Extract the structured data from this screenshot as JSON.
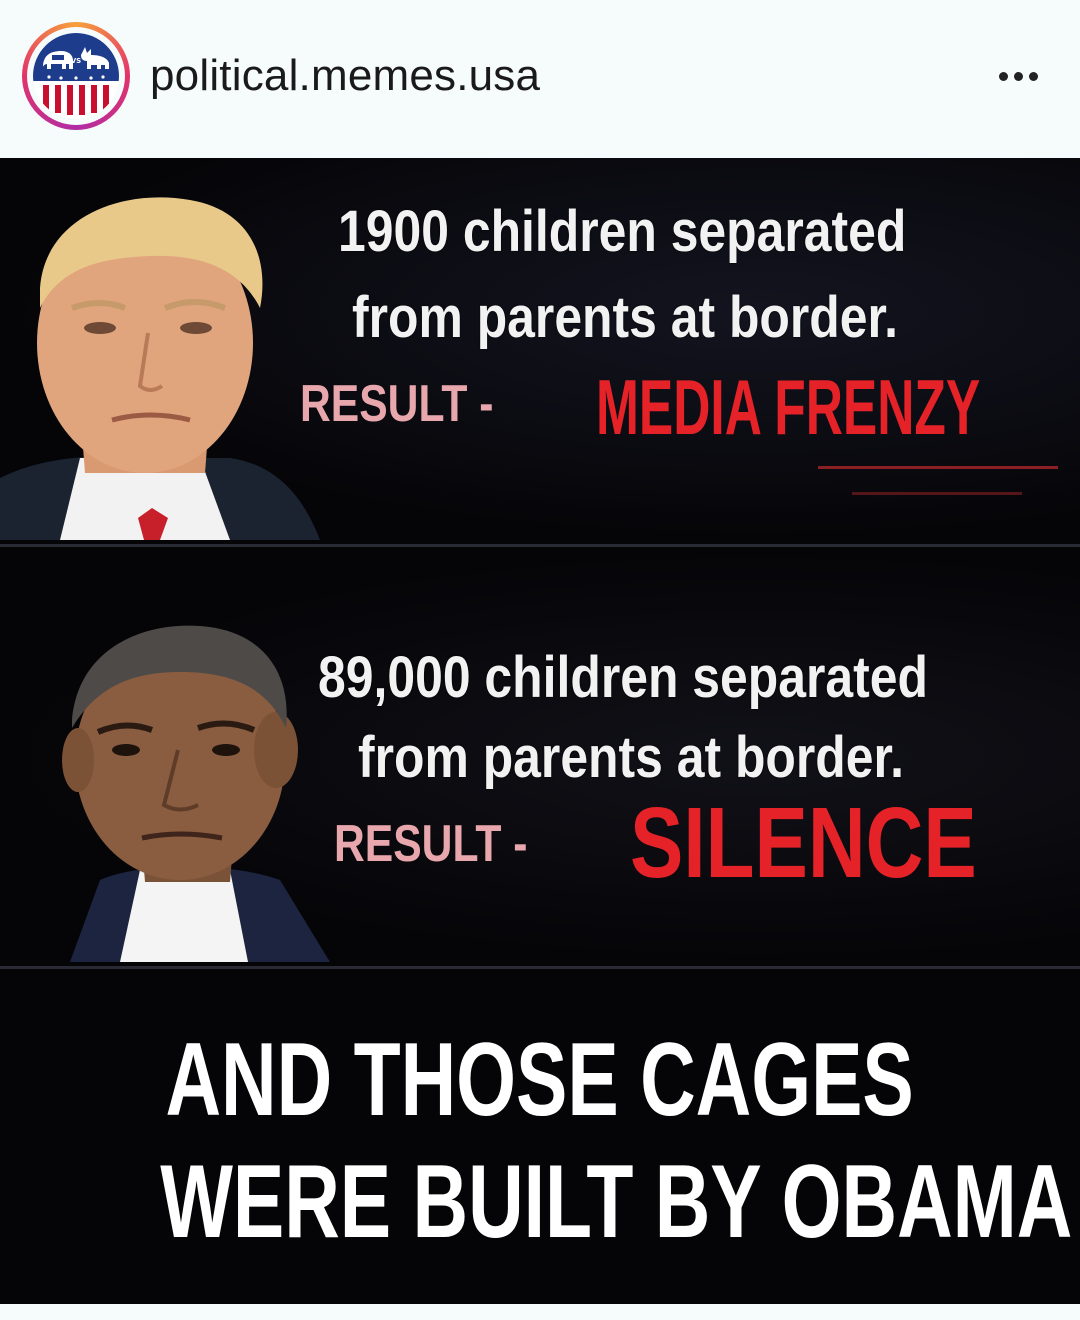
{
  "post": {
    "username": "political.memes.usa",
    "avatar_icon": "elephant-donkey-flag-logo",
    "more_icon": "more-options-icon"
  },
  "meme": {
    "top_panel": {
      "line1": "1900 children separated",
      "line2": "from parents at border.",
      "result_label": "RESULT -",
      "result_value": "MEDIA FRENZY"
    },
    "middle_panel": {
      "line1": "89,000 children separated",
      "line2": "from parents at border.",
      "result_label": "RESULT -",
      "result_value": "SILENCE"
    },
    "bottom_panel": {
      "line1": "AND THOSE CAGES",
      "line2": "WERE BUILT BY OBAMA"
    }
  },
  "colors": {
    "background": "#050508",
    "result_red": "#e42227",
    "result_label_pink": "#e8a7ad",
    "header_bg": "#f6fbfb"
  }
}
